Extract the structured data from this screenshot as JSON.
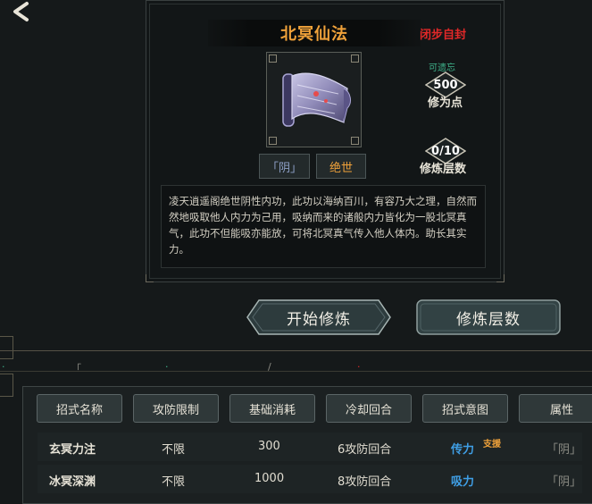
{
  "technique": {
    "title": "北冥仙法",
    "sealed_status": "闭步自封",
    "tags": {
      "yin": "「阴」",
      "peerless": "绝世"
    },
    "forgettable": "可遗忘",
    "cultivation_points": {
      "value": "500",
      "label": "修为点"
    },
    "layers": {
      "value": "0/10",
      "label": "修炼层数"
    },
    "description": "凌天逍遥阁绝世阴性内功，此功以海纳百川，有容乃大之理，自然而然地吸取他人内力为己用，吸纳而来的诸般内力皆化为一股北冥真气，此功不但能吸亦能放，可将北冥真气传入他人体内。助长其实力。"
  },
  "actions": {
    "start": "开始修炼",
    "layers": "修炼层数"
  },
  "skills": {
    "headers": [
      "招式名称",
      "攻防限制",
      "基础消耗",
      "冷却回合",
      "招式意图",
      "属性"
    ],
    "rows": [
      {
        "name": "玄冥力注",
        "limit": "不限",
        "cost": "300",
        "cooldown": "6攻防回合",
        "intent": "传力",
        "badge": "支援",
        "attr": "「阴」"
      },
      {
        "name": "冰冥深渊",
        "limit": "不限",
        "cost": "1000",
        "cooldown": "8攻防回合",
        "intent": "吸力",
        "badge": "",
        "attr": "「阴」"
      }
    ]
  },
  "icons": {
    "back": "back-arrow-icon",
    "scroll": "scroll-icon",
    "diamond": "diamond-frame-icon"
  },
  "colors": {
    "title": "#f0a23a",
    "sealed": "#e22828",
    "intent": "#3f9fe6",
    "forgettable": "#3fb48c"
  }
}
